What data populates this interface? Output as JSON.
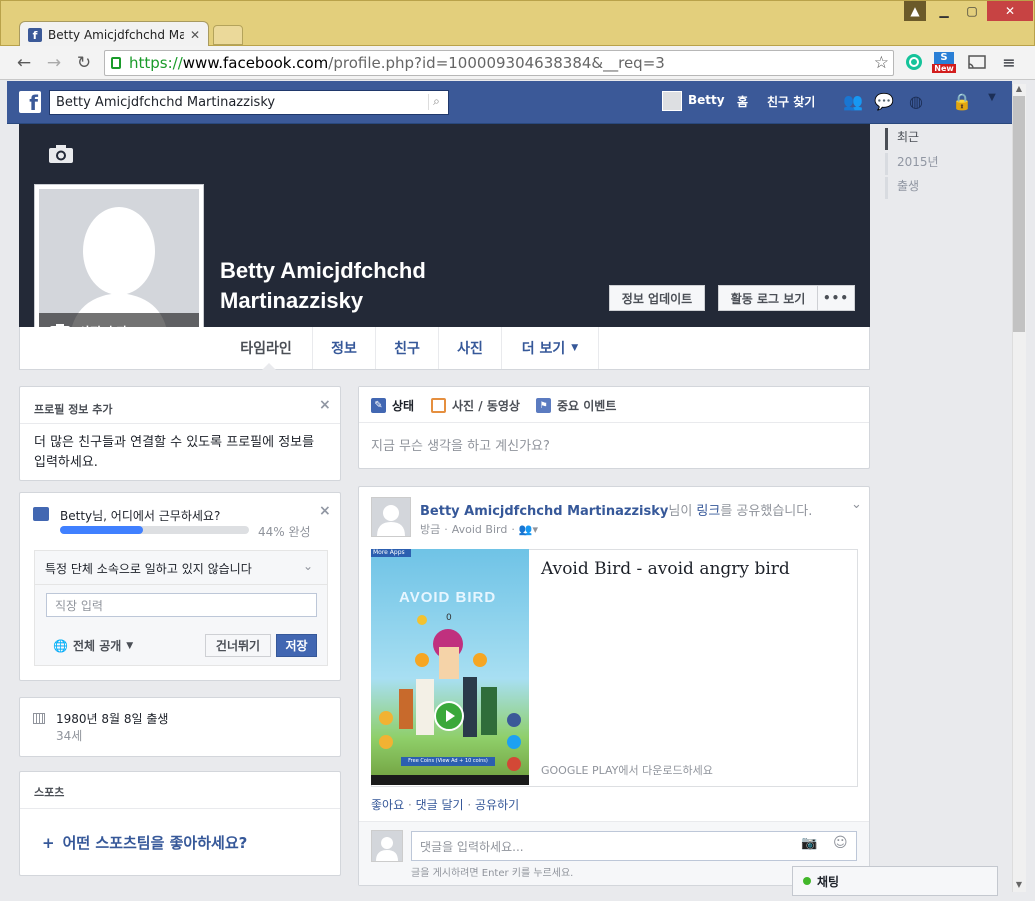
{
  "browser": {
    "tab_title": "Betty Amicjdfchchd Marti",
    "url_scheme": "https://",
    "url_host": "www.facebook.com",
    "url_path": "/profile.php?id=100009304638384&__req=3",
    "ext_new_badge": "New"
  },
  "fb": {
    "search_value": "Betty Amicjdfchchd Martinazzisky",
    "nav_user": "Betty",
    "nav_home": "홈",
    "nav_find_friends": "친구 찾기",
    "brand_color": "#3b5998"
  },
  "profile": {
    "name_line1": "Betty Amicjdfchchd",
    "name_line2": "Martinazzisky",
    "add_photo": "사진 추가",
    "update_info": "정보 업데이트",
    "view_activity_log": "활동 로그 보기",
    "more_dots": "•••",
    "tabs": [
      "타임라인",
      "정보",
      "친구",
      "사진",
      "더 보기"
    ]
  },
  "timeline_nav": [
    "최근",
    "2015년",
    "출생"
  ],
  "left": {
    "add_info_title": "프로필 정보 추가",
    "add_info_body": "더 많은 친구들과 연결할 수 있도록 프로필에 정보를 입력하세요.",
    "work_question": "Betty님, 어디에서 근무하세요?",
    "progress_text": "44% 완성",
    "progress_value": 44,
    "no_org_option": "특정 단체 소속으로 일하고 있지 않습니다",
    "workplace_placeholder": "직장 입력",
    "privacy_label": "전체 공개",
    "skip_label": "건너뛰기",
    "save_label": "저장",
    "birthday_text": "1980년 8월 8일 출생",
    "age_text": "34세",
    "sports_title": "스포츠",
    "sports_prompt": "어떤 스포츠팀을 좋아하세요?"
  },
  "composer": {
    "status_tab": "상태",
    "photo_tab": "사진 / 동영상",
    "event_tab": "중요 이벤트",
    "placeholder": "지금 무슨 생각을 하고 계신가요?"
  },
  "post": {
    "author": "Betty Amicjdfchchd Martinazzisky",
    "action_text": "님이 ",
    "action_link": "링크",
    "action_end": "를 공유했습니다.",
    "time": "방금",
    "app_name": "Avoid Bird",
    "link_title": "Avoid Bird - avoid angry bird",
    "link_source": "GOOGLE PLAY에서 다운로드하세요",
    "game_more_apps": "More Apps",
    "game_title": "AVOID BIRD",
    "game_score": "0",
    "game_free_coins": "Free Coins (View Ad + 10 coins)",
    "actions_like": "좋아요",
    "actions_comment": "댓글 달기",
    "actions_share": "공유하기",
    "actions_sep": " · ",
    "comment_placeholder": "댓글을 입력하세요...",
    "comment_hint": "글을 게시하려면 Enter 키를 누르세요."
  },
  "chat": {
    "label": "채팅"
  }
}
